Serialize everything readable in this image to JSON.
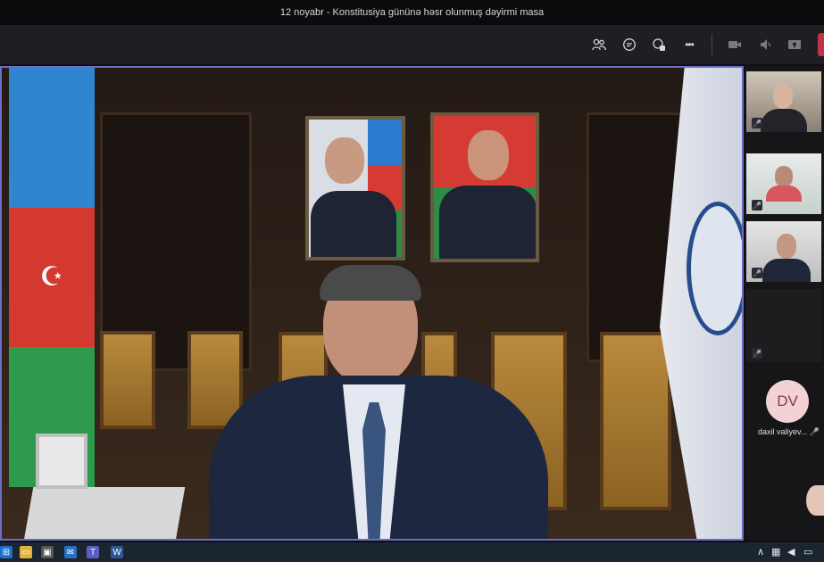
{
  "window": {
    "title": "12 noyabr - Konstitusiya gününə həsr olunmuş dəyirmi masa"
  },
  "toolbar": {
    "icons": [
      "participants-icon",
      "chat-icon",
      "reactions-icon",
      "more-options-icon",
      "camera-off-icon",
      "mic-muted-icon",
      "share-screen-icon"
    ],
    "more_label": "•••"
  },
  "gallery": {
    "participant_initials": "DV",
    "participant_name": "daxil valiyev..."
  },
  "colors": {
    "stage_border": "#6c6fc7",
    "leave_button": "#c4314b",
    "avatar_bg": "#f3d2d6"
  }
}
